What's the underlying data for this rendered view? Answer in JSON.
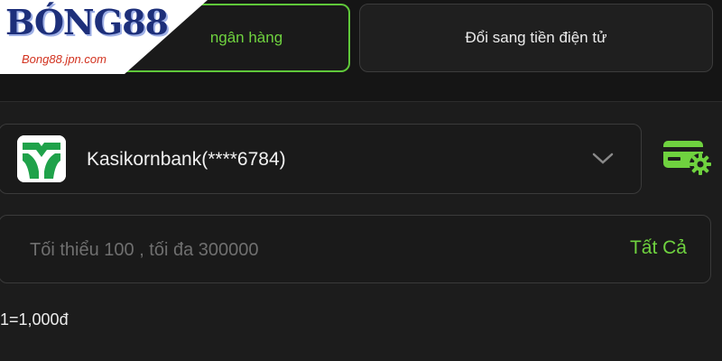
{
  "logo": {
    "brand": "BÓNG88",
    "url": "Bong88.jpn.com"
  },
  "tabs": [
    {
      "label": "ngân hàng",
      "active": true
    },
    {
      "label": "Đổi sang tiền điện tử",
      "active": false
    }
  ],
  "bank_select": {
    "selected": "Kasikornbank(****6784)",
    "icon": "kasikornbank-logo-icon"
  },
  "amount": {
    "placeholder": "Tối thiểu 100 , tối đa 300000",
    "value": "",
    "all_label": "Tất Cả"
  },
  "exchange_rate": "1=1,000đ",
  "colors": {
    "accent": "#6fd23f",
    "background": "#1c1c1c"
  }
}
